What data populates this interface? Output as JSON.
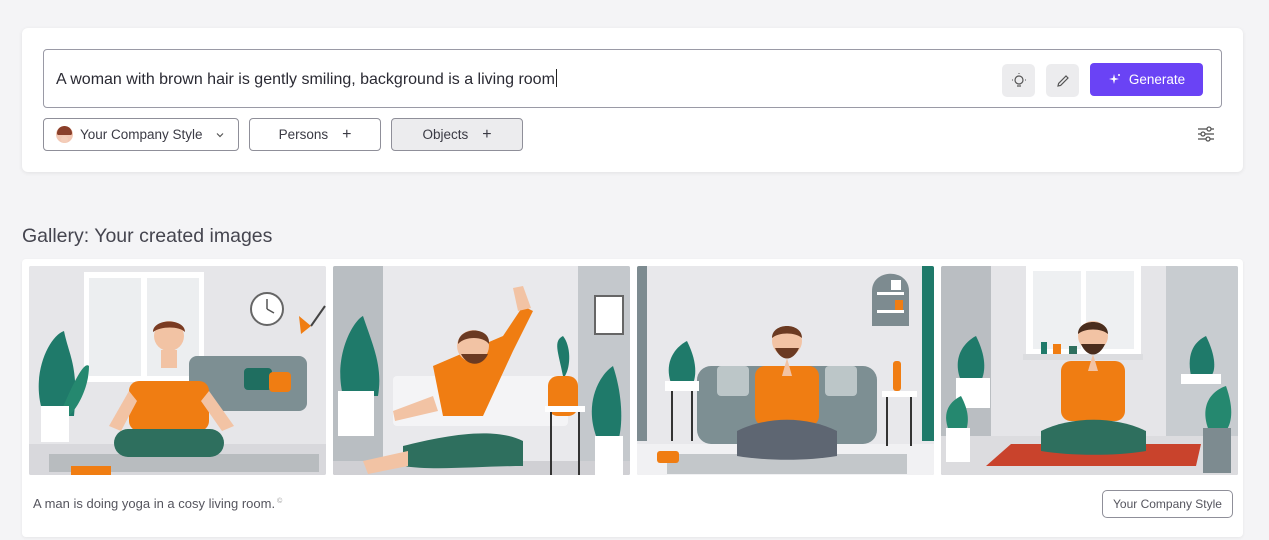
{
  "prompt": {
    "text": "A woman with brown hair is gently smiling, background is a living room",
    "ideas_icon": "lightbulb-icon",
    "edit_icon": "pencil-icon",
    "generate_label": "Generate",
    "generate_icon": "sparkle-icon"
  },
  "options": {
    "style_label": "Your Company Style",
    "style_icon": "avatar-icon",
    "persons_label": "Persons",
    "objects_label": "Objects",
    "add_symbol": "+",
    "settings_icon": "sliders-icon"
  },
  "gallery": {
    "title": "Gallery: Your created images",
    "caption": "A man is doing yoga in a cosy living room.",
    "caption_mark": "©",
    "style_tag": "Your Company Style",
    "images": [
      {
        "name": "man-meditating-on-floor"
      },
      {
        "name": "man-stretching-on-floor"
      },
      {
        "name": "man-meditating-on-sofa"
      },
      {
        "name": "man-praying-on-mat"
      }
    ]
  },
  "colors": {
    "accent": "#6a43f5",
    "shirt_orange": "#f07d12",
    "plant_green": "#1f7a6a",
    "pants_teal": "#2e6f5e"
  }
}
